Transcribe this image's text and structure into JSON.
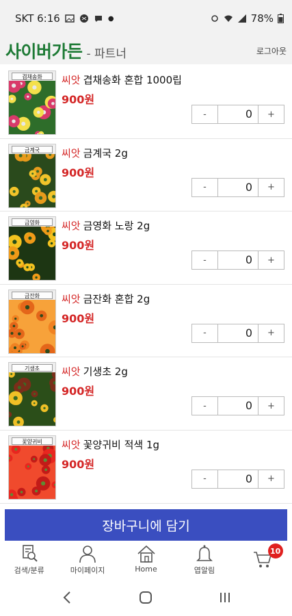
{
  "statusbar": {
    "carrier_time": "SKT 6:16",
    "battery": "78%"
  },
  "header": {
    "brand": "사이버가든",
    "brand_sub": "- 파트너",
    "logout": "로그아웃"
  },
  "products": [
    {
      "thumb_label": "겹채송화",
      "seed_tag": "씨앗",
      "name": "겹채송화  혼합 1000립",
      "price": "900원",
      "qty": "0",
      "minus": "-",
      "plus": "+",
      "palette": [
        "#d93a6a",
        "#f4e04c",
        "#e8e8e8",
        "#2e6d2a"
      ]
    },
    {
      "thumb_label": "금계국",
      "seed_tag": "씨앗",
      "name": "금계국   2g",
      "price": "900원",
      "qty": "0",
      "minus": "-",
      "plus": "+",
      "palette": [
        "#f2c42a",
        "#e79b1c",
        "#3a6a28",
        "#2a4a1c"
      ]
    },
    {
      "thumb_label": "금영화",
      "seed_tag": "씨앗",
      "name": "금영화  노랑 2g",
      "price": "900원",
      "qty": "0",
      "minus": "-",
      "plus": "+",
      "palette": [
        "#f3c21f",
        "#f09a18",
        "#244d1a",
        "#1d3613"
      ]
    },
    {
      "thumb_label": "금잔화",
      "seed_tag": "씨앗",
      "name": "금잔화  혼합 2g",
      "price": "900원",
      "qty": "0",
      "minus": "-",
      "plus": "+",
      "palette": [
        "#f08222",
        "#e4661a",
        "#2c4a1c",
        "#f7a23a"
      ]
    },
    {
      "thumb_label": "기생초",
      "seed_tag": "씨앗",
      "name": "기생초   2g",
      "price": "900원",
      "qty": "0",
      "minus": "-",
      "plus": "+",
      "palette": [
        "#f0c026",
        "#7a2e1a",
        "#3b6b24",
        "#2b4e19"
      ]
    },
    {
      "thumb_label": "꽃양귀비",
      "seed_tag": "씨앗",
      "name": "꽃양귀비  적색 1g",
      "price": "900원",
      "qty": "0",
      "minus": "-",
      "plus": "+",
      "palette": [
        "#e8261f",
        "#c21b18",
        "#5f8a33",
        "#f04a2d"
      ]
    }
  ],
  "cart_button": "장바구니에 담기",
  "bottom_nav": [
    {
      "label": "검색/분류",
      "icon": "search-list-icon"
    },
    {
      "label": "마이페이지",
      "icon": "person-icon"
    },
    {
      "label": "Home",
      "icon": "home-icon"
    },
    {
      "label": "엽알림",
      "icon": "bell-icon"
    },
    {
      "label": "",
      "icon": "cart-icon",
      "badge": "10"
    }
  ],
  "colors": {
    "brand": "#1d7a35",
    "price": "#d42626",
    "cart_button": "#3a4ec0",
    "badge": "#e0201f"
  }
}
